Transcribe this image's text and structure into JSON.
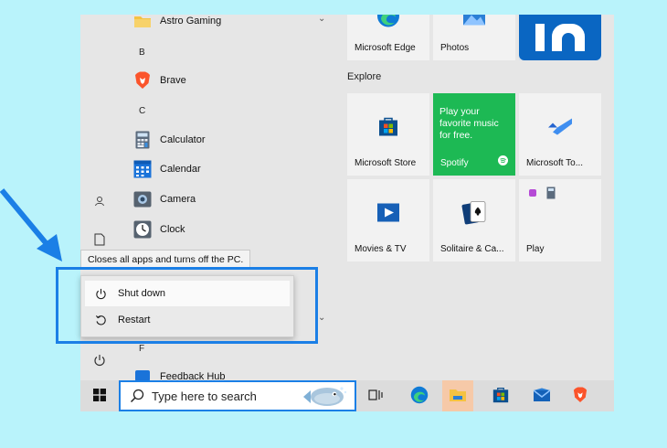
{
  "app_list": {
    "items": [
      {
        "label": "Astro Gaming",
        "icon": "folder-icon"
      },
      {
        "letter": "B"
      },
      {
        "label": "Brave",
        "icon": "brave-icon"
      },
      {
        "letter": "C"
      },
      {
        "label": "Calculator",
        "icon": "calculator-icon"
      },
      {
        "label": "Calendar",
        "icon": "calendar-icon"
      },
      {
        "label": "Camera",
        "icon": "camera-icon"
      },
      {
        "label": "Clock",
        "icon": "clock-icon"
      },
      {
        "letter": "F"
      },
      {
        "label": "Feedback Hub",
        "icon": "feedback-hub-icon"
      }
    ]
  },
  "tiles": {
    "top_row": [
      {
        "label": "Microsoft Edge"
      },
      {
        "label": "Photos"
      }
    ],
    "section_label": "Explore",
    "explore": [
      {
        "label": "Microsoft Store"
      },
      {
        "label": "Spotify",
        "promo": "Play your favorite music for free."
      },
      {
        "label": "Microsoft To..."
      },
      {
        "label": "Movies & TV"
      },
      {
        "label": "Solitaire & Ca..."
      },
      {
        "label": "Play"
      }
    ]
  },
  "tooltip": "Closes all apps and turns off the PC.",
  "power_menu": {
    "items": [
      {
        "label": "Shut down",
        "icon": "power-icon"
      },
      {
        "label": "Restart",
        "icon": "restart-icon"
      }
    ]
  },
  "taskbar": {
    "search_placeholder": "Type here to search",
    "icons": [
      "windows-start-icon",
      "search-icon",
      "task-view-icon",
      "edge-icon",
      "file-explorer-icon",
      "store-icon",
      "mail-icon",
      "brave-icon"
    ]
  },
  "colors": {
    "background": "#b9f3fb",
    "highlight": "#1b7fe6",
    "spotify_green": "#1db954",
    "linkedin_blue": "#0a66c2"
  }
}
